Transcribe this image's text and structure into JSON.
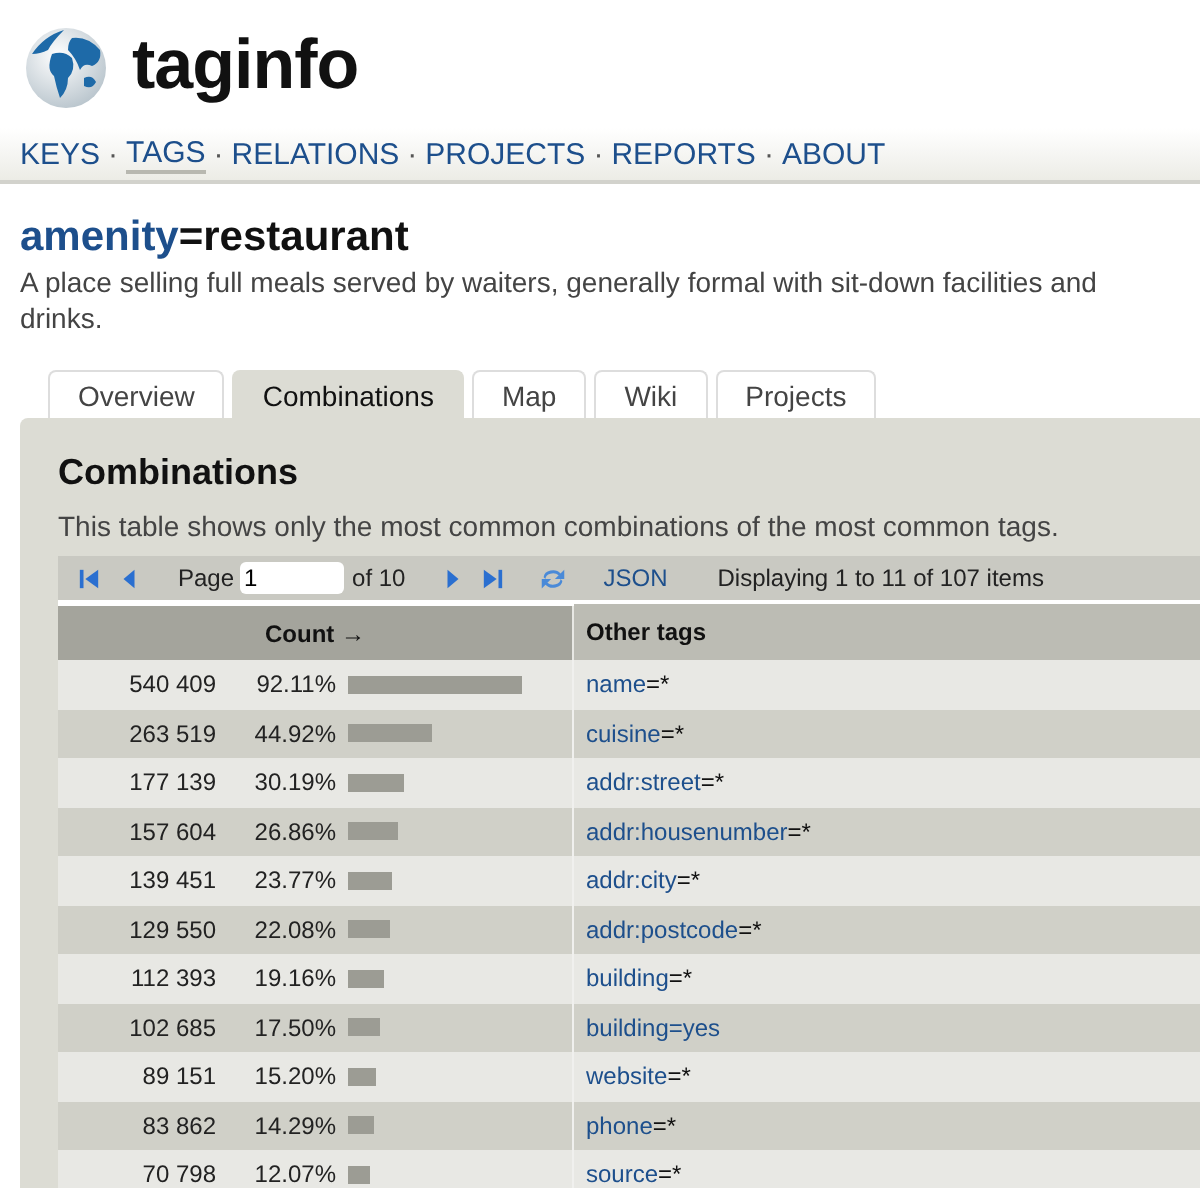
{
  "logo": {
    "text": "taginfo"
  },
  "nav": [
    {
      "label": "KEYS",
      "selected": false
    },
    {
      "label": "TAGS",
      "selected": true
    },
    {
      "label": "RELATIONS",
      "selected": false
    },
    {
      "label": "PROJECTS",
      "selected": false
    },
    {
      "label": "REPORTS",
      "selected": false
    },
    {
      "label": "ABOUT",
      "selected": false
    }
  ],
  "nav_separator": "·",
  "title": {
    "key": "amenity",
    "value": "=restaurant"
  },
  "description_lines": [
    "A place selling full meals served by waiters, generally formal with sit-down facilities and",
    "drinks."
  ],
  "tabs": [
    {
      "label": "Overview",
      "selected": false
    },
    {
      "label": "Combinations",
      "selected": true
    },
    {
      "label": "Map",
      "selected": false
    },
    {
      "label": "Wiki",
      "selected": false
    },
    {
      "label": "Projects",
      "selected": false
    }
  ],
  "section": {
    "heading": "Combinations",
    "text": "This table shows only the most common combinations of the most common tags."
  },
  "pager": {
    "page_label": "Page",
    "page_value": "1",
    "of": "of 10",
    "json": "JSON",
    "display": "Displaying 1 to 11 of 107 items"
  },
  "columns": [
    {
      "label": "Count →",
      "sorted": true
    },
    {
      "label": "Other tags",
      "sorted": false
    }
  ],
  "rows": [
    {
      "count": "540 409",
      "percent": "92.11%",
      "key": "name",
      "value": "=*",
      "value_link": false
    },
    {
      "count": "263 519",
      "percent": "44.92%",
      "key": "cuisine",
      "value": "=*",
      "value_link": false
    },
    {
      "count": "177 139",
      "percent": "30.19%",
      "key": "addr:street",
      "value": "=*",
      "value_link": false
    },
    {
      "count": "157 604",
      "percent": "26.86%",
      "key": "addr:housenumber",
      "value": "=*",
      "value_link": false
    },
    {
      "count": "139 451",
      "percent": "23.77%",
      "key": "addr:city",
      "value": "=*",
      "value_link": false
    },
    {
      "count": "129 550",
      "percent": "22.08%",
      "key": "addr:postcode",
      "value": "=*",
      "value_link": false
    },
    {
      "count": "112 393",
      "percent": "19.16%",
      "key": "building",
      "value": "=*",
      "value_link": false
    },
    {
      "count": "102 685",
      "percent": "17.50%",
      "key": "building",
      "value": "=yes",
      "value_link": true
    },
    {
      "count": "89 151",
      "percent": "15.20%",
      "key": "website",
      "value": "=*",
      "value_link": false
    },
    {
      "count": "83 862",
      "percent": "14.29%",
      "key": "phone",
      "value": "=*",
      "value_link": false
    },
    {
      "count": "70 798",
      "percent": "12.07%",
      "key": "source",
      "value": "=*",
      "value_link": false
    }
  ]
}
